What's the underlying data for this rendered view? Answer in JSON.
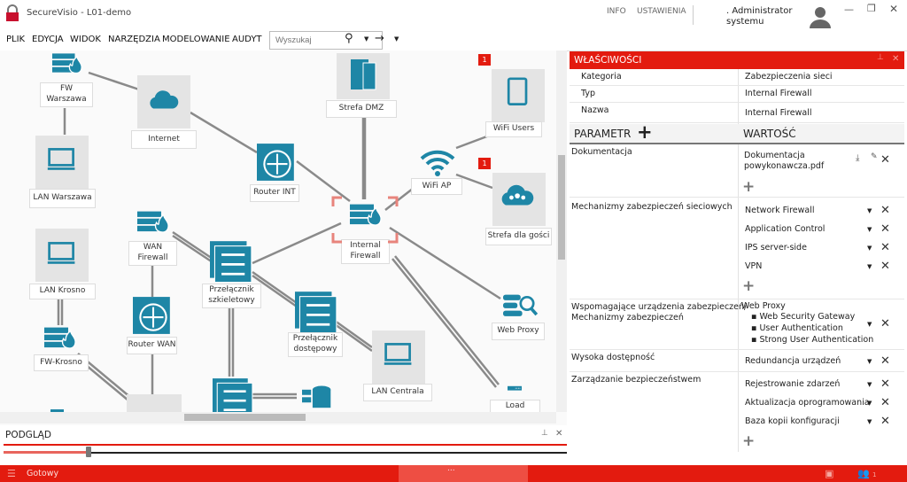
{
  "window": {
    "title": "SecureVisio - L01-demo",
    "links": [
      "INFO",
      "USTAWIENIA"
    ],
    "user": ". Administrator",
    "user_sub": "systemu",
    "controls": [
      "minimize",
      "restore",
      "close"
    ]
  },
  "menu": [
    "PLIK",
    "EDYCJA",
    "WIDOK",
    "NARZĘDZIA",
    "MODELOWANIE",
    "AUDYT"
  ],
  "search": {
    "placeholder": "Wyszukaj"
  },
  "diagram": {
    "nodes": [
      {
        "id": "fw-warszawa",
        "label": "FW\nWarszawa",
        "icon": "firewall"
      },
      {
        "id": "internet",
        "label": "Internet",
        "icon": "cloud"
      },
      {
        "id": "lan-warszawa",
        "label": "LAN Warszawa",
        "icon": "monitor"
      },
      {
        "id": "strefa-dmz",
        "label": "Strefa DMZ",
        "icon": "server"
      },
      {
        "id": "wifi-users",
        "label": "WiFi Users",
        "icon": "tablet",
        "badge": "1"
      },
      {
        "id": "router-int",
        "label": "Router INT",
        "icon": "router"
      },
      {
        "id": "wifi-ap",
        "label": "WiFi AP",
        "icon": "wifi"
      },
      {
        "id": "strefa-gosci",
        "label": "Strefa dla gości",
        "icon": "cloud-users",
        "badge": "1"
      },
      {
        "id": "internal-firewall",
        "label": "Internal\nFirewall",
        "icon": "firewall",
        "selected": true
      },
      {
        "id": "wan-firewall",
        "label": "WAN\nFirewall",
        "icon": "firewall"
      },
      {
        "id": "lan-krosno",
        "label": "LAN Krosno",
        "icon": "monitor"
      },
      {
        "id": "przelacznik-szkieletowy",
        "label": "Przełącznik\nszkieletowy",
        "icon": "switch"
      },
      {
        "id": "router-wan",
        "label": "Router WAN",
        "icon": "router"
      },
      {
        "id": "przelacznik-dostepowy",
        "label": "Przełącznik\ndostępowy",
        "icon": "switch"
      },
      {
        "id": "web-proxy",
        "label": "Web Proxy",
        "icon": "proxy"
      },
      {
        "id": "fw-krosno",
        "label": "FW-Krosno",
        "icon": "firewall"
      },
      {
        "id": "lan-centrala",
        "label": "LAN Centrala",
        "icon": "monitor"
      },
      {
        "id": "load",
        "label": "Load",
        "icon": "load-balancer"
      }
    ]
  },
  "preview": {
    "title": "PODGLĄD",
    "zoom_fraction": 0.16
  },
  "properties": {
    "title": "WŁAŚCIWOŚCI",
    "basic": [
      {
        "key": "Kategoria",
        "value": "Zabezpieczenia sieci"
      },
      {
        "key": "Typ",
        "value": "Internal Firewall"
      },
      {
        "key": "Nazwa",
        "value": "Internal Firewall"
      }
    ],
    "param_header": "PARAMETR",
    "value_header": "WARTOŚĆ",
    "params": [
      {
        "name": "Dokumentacja",
        "values": [
          "Dokumentacja\npowykonawcza.pdf"
        ]
      },
      {
        "name": "Mechanizmy zabezpieczeń sieciowych",
        "values": [
          "Network Firewall",
          "Application Control",
          "IPS server-side",
          "VPN"
        ]
      },
      {
        "name": "Wspomagające urządzenia zabezpieczeń/\nMechanizmy zabezpieczeń",
        "values": [
          "Web Proxy"
        ],
        "subitems": [
          "Web Security Gateway",
          "User Authentication",
          "Strong User Authentication"
        ]
      },
      {
        "name": "Wysoka dostępność",
        "values": [
          "Redundancja urządzeń"
        ]
      },
      {
        "name": "Zarządzanie bezpieczeństwem",
        "values": [
          "Rejestrowanie zdarzeń",
          "Aktualizacja oprogramowania",
          "Baza kopii konfiguracji"
        ]
      }
    ]
  },
  "status": {
    "text": "Gotowy",
    "dots": "...",
    "users_count": "1"
  },
  "colors": {
    "accent": "#e31b0f",
    "icon": "#1e86a6",
    "line": "#8a8a8a"
  }
}
